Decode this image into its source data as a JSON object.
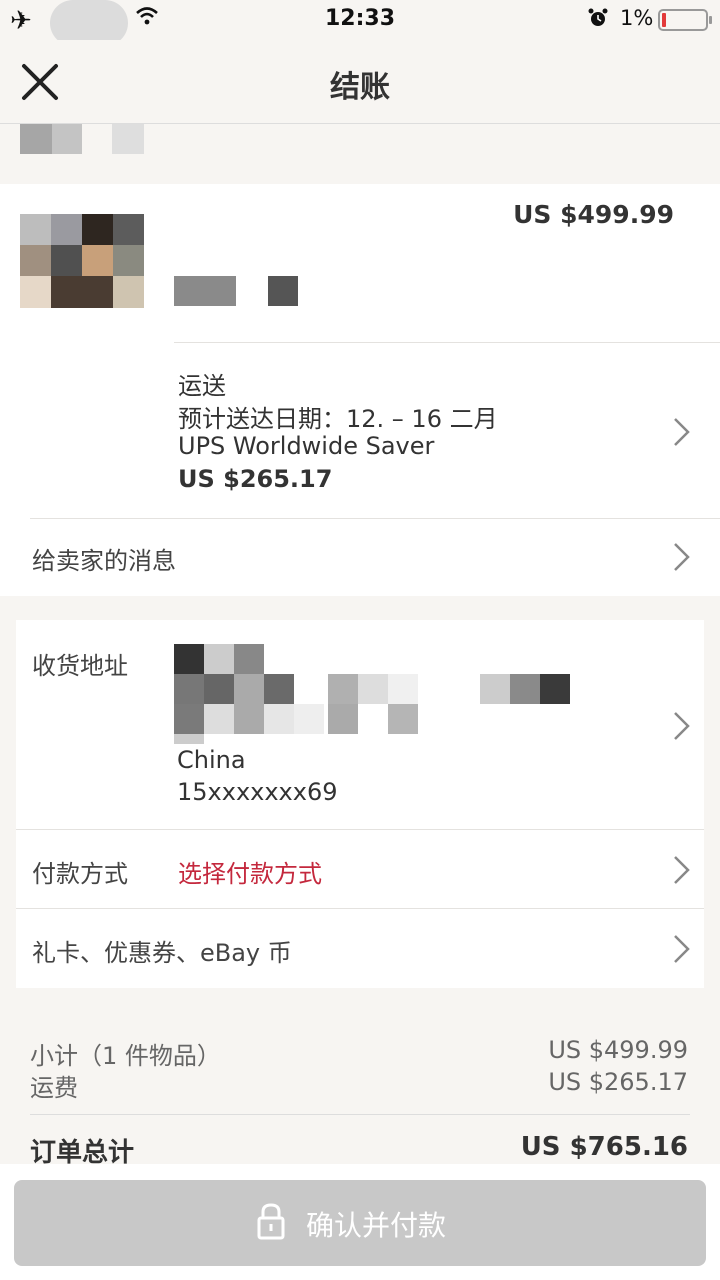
{
  "status_bar": {
    "time": "12:33",
    "battery_pct": "1%"
  },
  "header": {
    "title": "结账"
  },
  "item": {
    "price": "US $499.99"
  },
  "shipping": {
    "label": "运送",
    "eta": "预计送达日期：12. – 16 二月",
    "service": "UPS Worldwide Saver",
    "cost": "US $265.17"
  },
  "seller_message": {
    "label": "给卖家的消息"
  },
  "address": {
    "label": "收货地址",
    "country": "China",
    "phone": "15xxxxxxx69"
  },
  "payment": {
    "label": "付款方式",
    "value": "选择付款方式",
    "accent": "#c4283d"
  },
  "gift": {
    "label": "礼卡、优惠券、eBay 币"
  },
  "summary": {
    "subtotal_label": "小计（1 件物品）",
    "subtotal_value": "US $499.99",
    "shipping_label": "运费",
    "shipping_value": "US $265.17",
    "total_label": "订单总计",
    "total_value": "US $765.16"
  },
  "confirm_button": {
    "label": "确认并付款"
  }
}
